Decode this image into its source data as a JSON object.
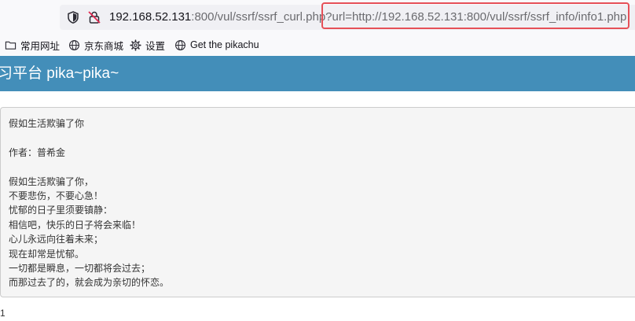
{
  "browser": {
    "url_host": "192.168.52.131",
    "url_rest": ":800/vul/ssrf/ssrf_curl.php?url=http://192.168.52.131:800/vul/ssrf/ssrf_info/info1.php",
    "highlight_color": "#e65058",
    "icons": [
      "shield-icon",
      "insecure-lock-icon"
    ]
  },
  "bookmarks": [
    {
      "label": "常用网址",
      "icon": "folder-icon"
    },
    {
      "label": "京东商城",
      "icon": "globe-icon"
    },
    {
      "label": "设置",
      "icon": "gear-icon"
    },
    {
      "label": "Get the pikachu",
      "icon": "globe-icon"
    }
  ],
  "header": {
    "title": "练习平台 pika~pika~",
    "bg_color": "#438eb9"
  },
  "content": {
    "title": "假如生活欺骗了你",
    "author": "作者：普希金",
    "lines": [
      "假如生活欺骗了你，",
      "不要悲伤，不要心急！",
      "忧郁的日子里须要镇静：",
      "相信吧，快乐的日子将会来临！",
      "心儿永远向往着未来；",
      "现在却常是忧郁。",
      "一切都是瞬息，一切都将会过去；",
      "而那过去了的，就会成为亲切的怀恋。"
    ]
  },
  "footer": {
    "number": "1"
  }
}
